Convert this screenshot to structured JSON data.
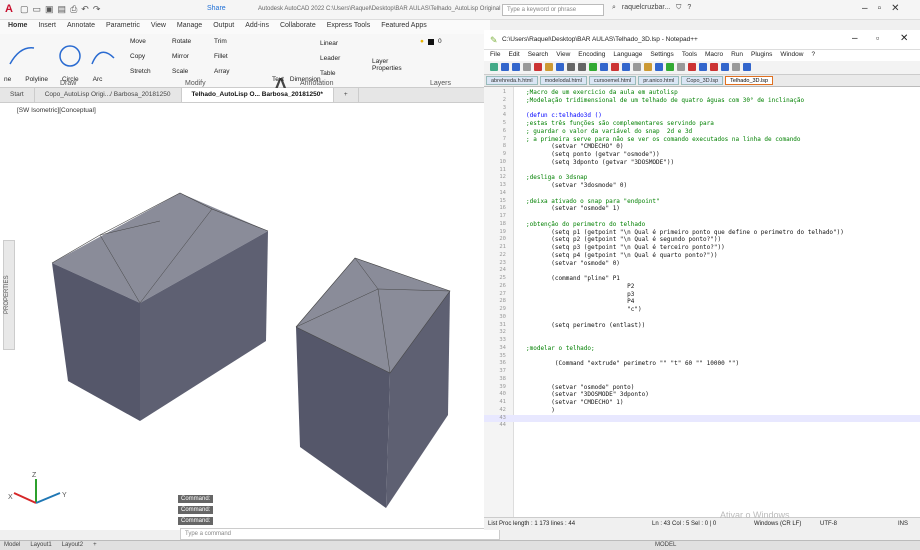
{
  "autocad": {
    "logo": "A",
    "share_label": "Share",
    "title": "Autodesk AutoCAD 2022   C:\\Users\\Raquel\\Desktop\\BAR AULAS\\Telhado_AutoLisp Original Raquel Barbosa_20181250.dwg",
    "search_placeholder": "Type a keyword or phrase",
    "user": "raquelcruzbar...",
    "ribbon_tabs": [
      "Home",
      "Insert",
      "Annotate",
      "Parametric",
      "View",
      "Manage",
      "Output",
      "Add-ins",
      "Collaborate",
      "Express Tools",
      "Featured Apps"
    ],
    "draw_tools": [
      "ne",
      "Polyline",
      "Circle",
      "Arc"
    ],
    "modify_tools": [
      "Move",
      "Rotate",
      "Trim",
      "Copy",
      "Mirror",
      "Fillet",
      "Stretch",
      "Scale",
      "Array"
    ],
    "annotation_tools": [
      "Text",
      "Dimension",
      "Linear",
      "Leader",
      "Table"
    ],
    "layer_tools": [
      "Layer",
      "Properties"
    ],
    "layer_value": "0",
    "panel_labels": {
      "draw": "Draw",
      "modify": "Modify",
      "annotation": "Annotation",
      "layers": "Layers"
    },
    "doc_tabs": [
      "Start",
      "Copo_AutoLisp Origi.../ Barbosa_20181250",
      "Telhado_AutoLisp O... Barbosa_20181250*",
      "+"
    ],
    "viewport_label": "[SW Isometric][Conceptual]",
    "properties_label": "PROPERTIES",
    "command_history": [
      "Command:",
      "Command:",
      "Command:"
    ],
    "command_placeholder": "Type a command",
    "layout_tabs": [
      "Model",
      "Layout1",
      "Layout2",
      "+"
    ],
    "status_model": "MODEL",
    "colors": {
      "accent": "#c8102e",
      "solid_side": "#5b5d6b",
      "solid_top": "#8a8c99"
    }
  },
  "notepad": {
    "title": "C:\\Users\\Raquel\\Desktop\\BAR AULAS\\Telhado_3D.lsp - Notepad++",
    "menu": [
      "File",
      "Edit",
      "Search",
      "View",
      "Encoding",
      "Language",
      "Settings",
      "Tools",
      "Macro",
      "Run",
      "Plugins",
      "Window",
      "?"
    ],
    "tabs": [
      "abrehreda.h.html",
      "modelodal.html",
      "cursoemel.html",
      "pr.anico.html",
      "Copo_3D.lsp",
      "Telhado_3D.lsp"
    ],
    "lines": [
      {
        "n": "1",
        "t": ";Macro de um exercicio da aula em autolisp",
        "c": "com"
      },
      {
        "n": "2",
        "t": ";Modelação tridimensional de um telhado de quatro águas com 30° de inclinação",
        "c": "com"
      },
      {
        "n": "3",
        "t": "",
        "c": "def"
      },
      {
        "n": "4",
        "t": "(defun c:telhado3d ()",
        "c": "kw"
      },
      {
        "n": "5",
        "t": ";estas três funções são complementares servindo para",
        "c": "com"
      },
      {
        "n": "6",
        "t": "; guardar o valor da variável do snap  2d e 3d",
        "c": "com"
      },
      {
        "n": "7",
        "t": "; a primeira serve para não se ver os comando executados na linha de comando",
        "c": "com"
      },
      {
        "n": "8",
        "t": "       (setvar \"CMDECHO\" 0)",
        "c": "def"
      },
      {
        "n": "9",
        "t": "       (setq ponto (getvar \"osmode\"))",
        "c": "def"
      },
      {
        "n": "10",
        "t": "       (setq 3dponto (getvar \"3DOSMODE\"))",
        "c": "def"
      },
      {
        "n": "11",
        "t": "",
        "c": "def"
      },
      {
        "n": "12",
        "t": ";desliga o 3dsnap",
        "c": "com"
      },
      {
        "n": "13",
        "t": "       (setvar \"3dosmode\" 0)",
        "c": "def"
      },
      {
        "n": "14",
        "t": "",
        "c": "def"
      },
      {
        "n": "15",
        "t": ";deixa ativado o snap para \"endpoint\"",
        "c": "com"
      },
      {
        "n": "16",
        "t": "       (setvar \"osmode\" 1)",
        "c": "def"
      },
      {
        "n": "17",
        "t": "",
        "c": "def"
      },
      {
        "n": "18",
        "t": ";obtenção do perimetro do telhado",
        "c": "com"
      },
      {
        "n": "19",
        "t": "       (setq p1 (getpoint \"\\n Qual é primeiro ponto que define o perimetro do telhado\"))",
        "c": "def"
      },
      {
        "n": "20",
        "t": "       (setq p2 (getpoint \"\\n Qual é segundo ponto?\"))",
        "c": "def"
      },
      {
        "n": "21",
        "t": "       (setq p3 (getpoint \"\\n Qual é terceiro ponto?\"))",
        "c": "def"
      },
      {
        "n": "22",
        "t": "       (setq p4 (getpoint \"\\n Qual é quarto ponto?\"))",
        "c": "def"
      },
      {
        "n": "23",
        "t": "       (setvar \"osmode\" 0)",
        "c": "def"
      },
      {
        "n": "24",
        "t": "",
        "c": "def"
      },
      {
        "n": "25",
        "t": "       (command \"pline\" P1",
        "c": "def"
      },
      {
        "n": "26",
        "t": "                            P2",
        "c": "def"
      },
      {
        "n": "27",
        "t": "                            p3",
        "c": "def"
      },
      {
        "n": "28",
        "t": "                            P4",
        "c": "def"
      },
      {
        "n": "29",
        "t": "                            \"c\")",
        "c": "def"
      },
      {
        "n": "30",
        "t": "",
        "c": "def"
      },
      {
        "n": "31",
        "t": "       (setq perimetro (entlast))",
        "c": "def"
      },
      {
        "n": "32",
        "t": "",
        "c": "def"
      },
      {
        "n": "33",
        "t": "",
        "c": "def"
      },
      {
        "n": "34",
        "t": ";modelar o telhado;",
        "c": "com"
      },
      {
        "n": "35",
        "t": "",
        "c": "def"
      },
      {
        "n": "36",
        "t": "        (Command \"extrude\" perimetro \"\" \"t\" 60 \"\" 10000 \"\")",
        "c": "def"
      },
      {
        "n": "37",
        "t": "",
        "c": "def"
      },
      {
        "n": "38",
        "t": "",
        "c": "def"
      },
      {
        "n": "39",
        "t": "       (setvar \"osmode\" ponto)",
        "c": "def"
      },
      {
        "n": "40",
        "t": "       (setvar \"3DOSMODE\" 3dponto)",
        "c": "def"
      },
      {
        "n": "41",
        "t": "       (setvar \"CMDECHO\" 1)",
        "c": "def"
      },
      {
        "n": "42",
        "t": "       )",
        "c": "def"
      },
      {
        "n": "43",
        "t": "",
        "c": "def"
      },
      {
        "n": "44",
        "t": "",
        "c": "def"
      }
    ],
    "status_left": "List Proc length : 1 173    lines : 44",
    "status_pos": "Ln : 43    Col : 5    Sel : 0 | 0",
    "status_eol": "Windows (CR LF)",
    "status_enc": "UTF-8",
    "status_ins": "INS",
    "watermark": "Ativar o Windows"
  }
}
